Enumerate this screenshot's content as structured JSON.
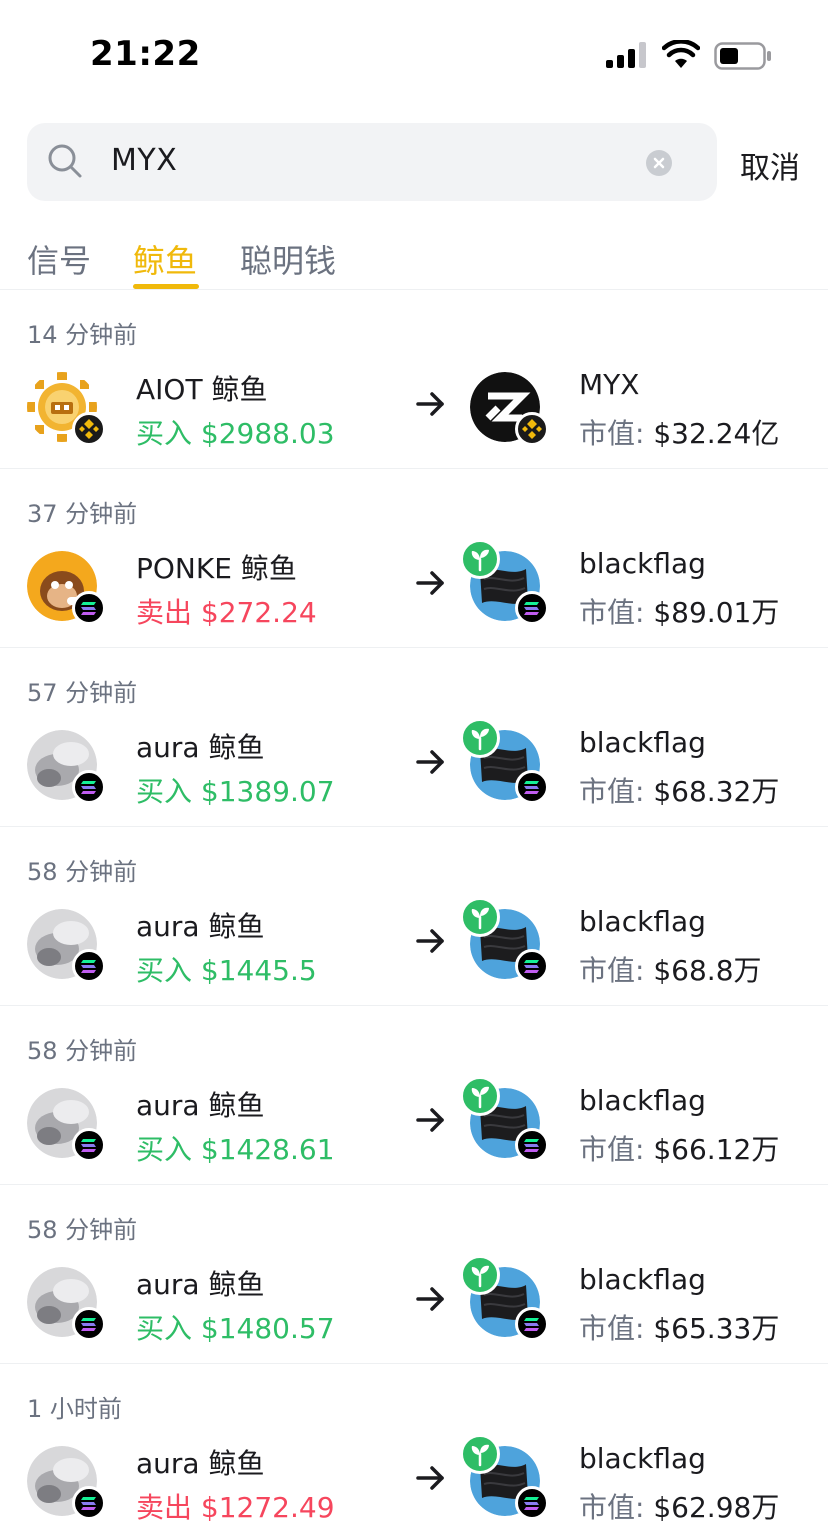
{
  "status_bar": {
    "time": "21:22"
  },
  "search": {
    "value": "MYX",
    "cancel_label": "取消"
  },
  "tabs": [
    {
      "label": "信号",
      "active": false
    },
    {
      "label": "鲸鱼",
      "active": true
    },
    {
      "label": "聪明钱",
      "active": false
    }
  ],
  "colors": {
    "accent": "#f0b90b",
    "buy": "#2ebd66",
    "sell": "#f6465d",
    "muted": "#6b7280"
  },
  "market_cap_label": "市值:",
  "feed": [
    {
      "time": "14 分钟前",
      "whale": "AIOT 鲸鱼",
      "action": "买入",
      "amount": "$2988.03",
      "side": "buy",
      "source_icon": "aiot-coin-icon",
      "source_chain": "bnb-chain-icon",
      "token": "MYX",
      "token_icon": "myx-logo-icon",
      "token_chain": "bnb-chain-icon",
      "market_cap": "$32.24亿"
    },
    {
      "time": "37 分钟前",
      "whale": "PONKE 鲸鱼",
      "action": "卖出",
      "amount": "$272.24",
      "side": "sell",
      "source_icon": "ponke-monkey-icon",
      "source_chain": "solana-chain-icon",
      "token": "blackflag",
      "token_icon": "blackflag-icon",
      "token_chain": "solana-chain-icon",
      "market_cap": "$89.01万"
    },
    {
      "time": "57 分钟前",
      "whale": "aura 鲸鱼",
      "action": "买入",
      "amount": "$1389.07",
      "side": "buy",
      "source_icon": "aura-avatar-icon",
      "source_chain": "solana-chain-icon",
      "token": "blackflag",
      "token_icon": "blackflag-icon",
      "token_chain": "solana-chain-icon",
      "market_cap": "$68.32万"
    },
    {
      "time": "58 分钟前",
      "whale": "aura 鲸鱼",
      "action": "买入",
      "amount": "$1445.5",
      "side": "buy",
      "source_icon": "aura-avatar-icon",
      "source_chain": "solana-chain-icon",
      "token": "blackflag",
      "token_icon": "blackflag-icon",
      "token_chain": "solana-chain-icon",
      "market_cap": "$68.8万"
    },
    {
      "time": "58 分钟前",
      "whale": "aura 鲸鱼",
      "action": "买入",
      "amount": "$1428.61",
      "side": "buy",
      "source_icon": "aura-avatar-icon",
      "source_chain": "solana-chain-icon",
      "token": "blackflag",
      "token_icon": "blackflag-icon",
      "token_chain": "solana-chain-icon",
      "market_cap": "$66.12万"
    },
    {
      "time": "58 分钟前",
      "whale": "aura 鲸鱼",
      "action": "买入",
      "amount": "$1480.57",
      "side": "buy",
      "source_icon": "aura-avatar-icon",
      "source_chain": "solana-chain-icon",
      "token": "blackflag",
      "token_icon": "blackflag-icon",
      "token_chain": "solana-chain-icon",
      "market_cap": "$65.33万"
    },
    {
      "time": "1 小时前",
      "whale": "aura 鲸鱼",
      "action": "卖出",
      "amount": "$1272.49",
      "side": "sell",
      "source_icon": "aura-avatar-icon",
      "source_chain": "solana-chain-icon",
      "token": "blackflag",
      "token_icon": "blackflag-icon",
      "token_chain": "solana-chain-icon",
      "market_cap": "$62.98万"
    }
  ]
}
